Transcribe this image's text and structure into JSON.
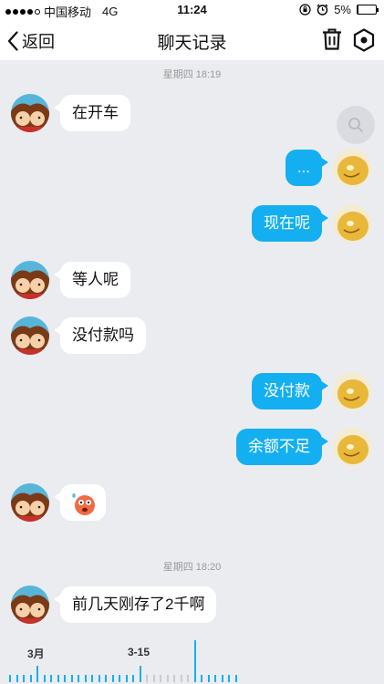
{
  "status": {
    "carrier": "中国移动",
    "network": "4G",
    "time": "11:24",
    "battery": "5%",
    "battery_level": 0.05
  },
  "nav": {
    "back_label": "返回",
    "title": "聊天记录"
  },
  "separators": [
    "星期四 18:19",
    "星期四 18:20"
  ],
  "messages": [
    {
      "side": "left",
      "text": "在开车"
    },
    {
      "side": "right",
      "text": "..."
    },
    {
      "side": "right",
      "text": "现在呢"
    },
    {
      "side": "left",
      "text": "等人呢"
    },
    {
      "side": "left",
      "text": "没付款吗"
    },
    {
      "side": "right",
      "text": "没付款"
    },
    {
      "side": "right",
      "text": "余额不足"
    },
    {
      "side": "left",
      "text": "",
      "emoji": "shocked-face"
    },
    {
      "side": "left",
      "text": "前几天刚存了2千啊"
    }
  ],
  "timeline": {
    "labels": [
      "3月",
      "3-15"
    ]
  },
  "colors": {
    "accent": "#14aff0",
    "background": "#ebecf0",
    "bubble_in": "#ffffff"
  }
}
